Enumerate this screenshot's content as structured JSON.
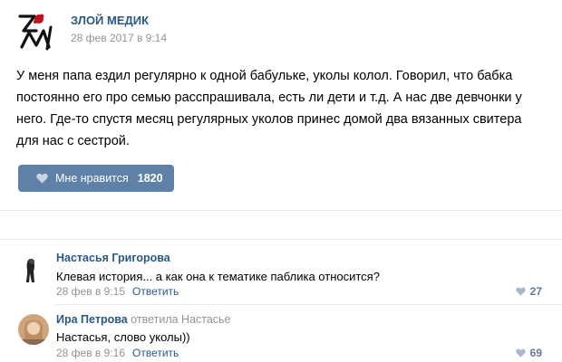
{
  "post": {
    "author": "ЗЛОЙ МЕДИК",
    "date": "28 фев 2017 в 9:14",
    "text": "У меня папа ездил регулярно к одной бабульке, уколы колол. Говорил, что бабка постоянно его про семью расспрашивала, есть ли дети и т.д. А нас две девчонки у него. Где-то спустя месяц регулярных уколов принес домой два вязанных свитера для нас с сестрой.",
    "like_label": "Мне нравится",
    "like_count": "1820",
    "logo_icon": "zm-logo-icon"
  },
  "comments": [
    {
      "name": "Настасья Григорова",
      "replied_to": "",
      "text": "Клевая история... а как она к тематике паблика относится?",
      "date": "28 фев в 9:15",
      "reply_label": "Ответить",
      "likes": "27"
    },
    {
      "name": "Ира Петрова",
      "replied_to": "ответила Настасье",
      "text": "Настасья, слово уколы))",
      "date": "28 фев в 9:16",
      "reply_label": "Ответить",
      "likes": "69"
    }
  ],
  "colors": {
    "link": "#2a5885",
    "button": "#5e81a8",
    "muted": "#939393"
  }
}
